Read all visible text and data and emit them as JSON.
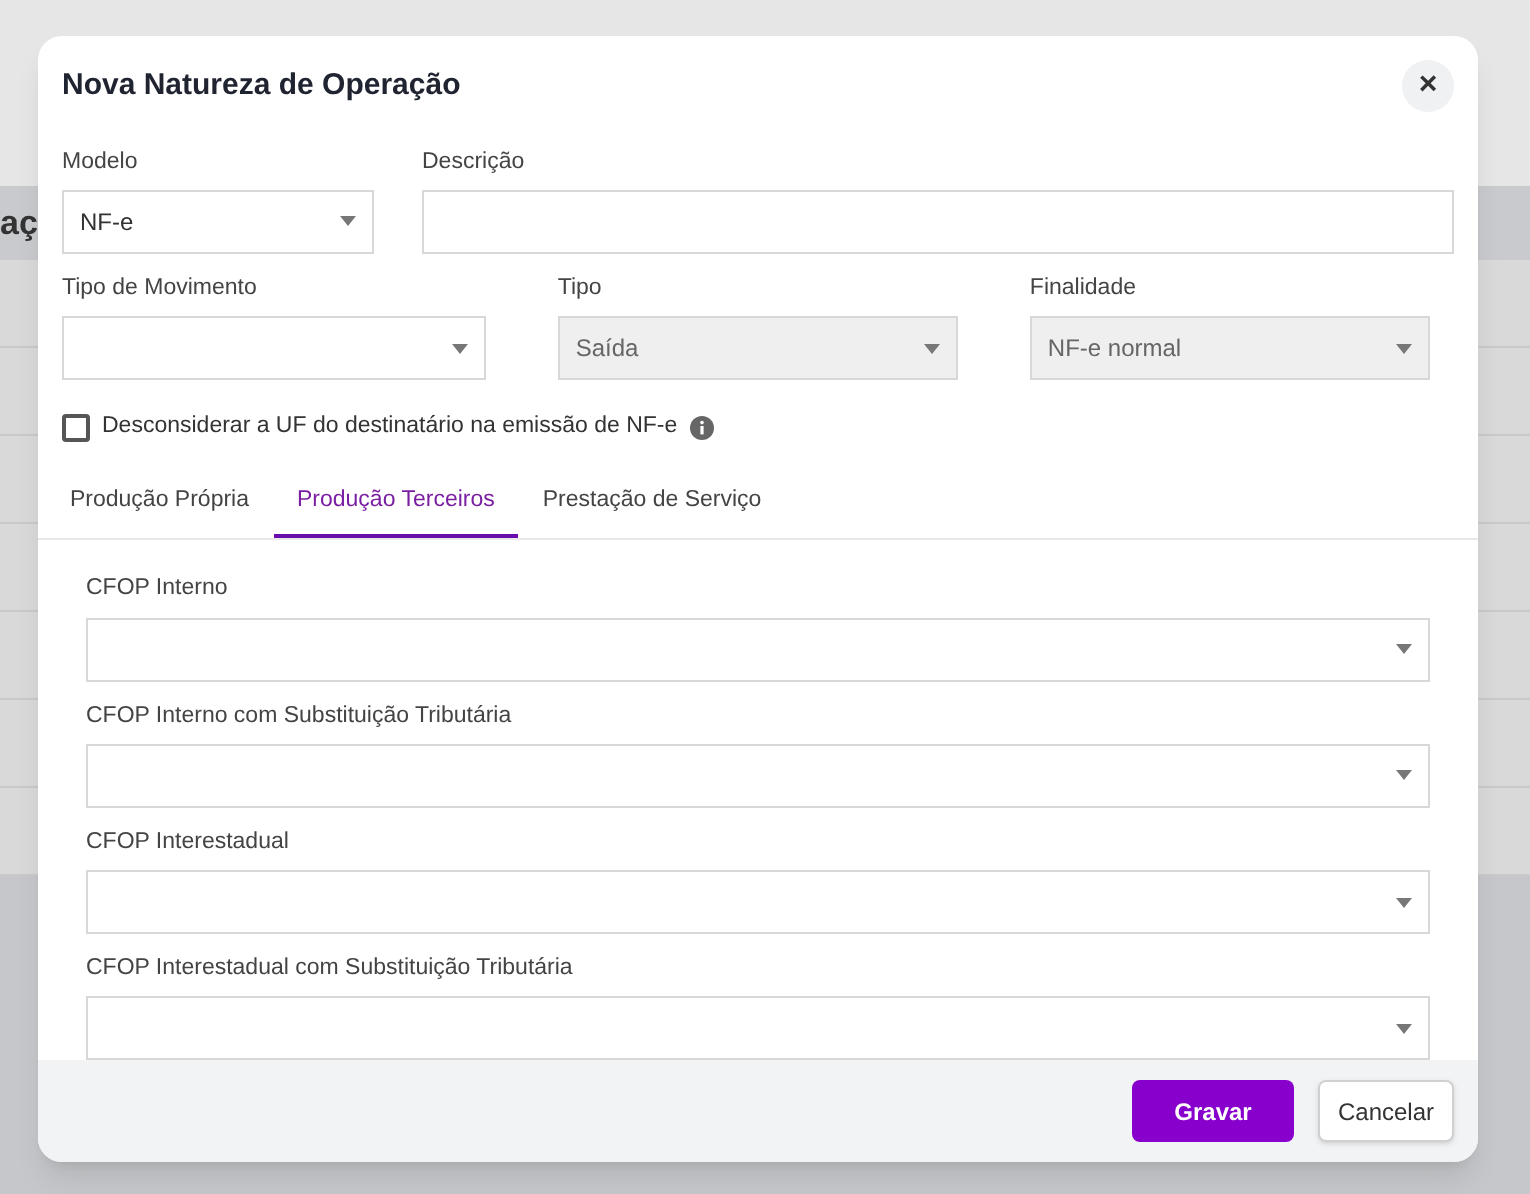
{
  "background_page": {
    "title_fragment": "aç"
  },
  "dialog": {
    "title": "Nova Natureza de Operação",
    "close_label": "×",
    "fields_row_1": [
      {
        "label": "Modelo",
        "kind": "select",
        "value": "NF-e",
        "disabled": false
      },
      {
        "label": "Descrição",
        "kind": "input",
        "disabled": false
      }
    ],
    "fields_row_2": [
      {
        "label": "Tipo de Movimento",
        "kind": "select",
        "disabled": false
      },
      {
        "label": "Tipo",
        "kind": "select",
        "value": "Saída",
        "disabled": true
      },
      {
        "label": "Finalidade",
        "kind": "select",
        "value": "NF-e normal",
        "disabled": true
      }
    ],
    "checkbox": {
      "label": "Desconsiderar a UF do destinatário na emissão de NF-e",
      "checked": false
    },
    "tabs": [
      {
        "label": "Produção Própria",
        "selected": false
      },
      {
        "label": "Produção Terceiros",
        "selected": true
      },
      {
        "label": "Prestação de Serviço",
        "selected": false
      }
    ],
    "cfop_fields": [
      {
        "label": "CFOP Interno"
      },
      {
        "label": "CFOP Interno com Substituição Tributária"
      },
      {
        "label": "CFOP Interestadual"
      },
      {
        "label": "CFOP Interestadual com Substituição Tributária"
      }
    ],
    "buttons": [
      {
        "label": "Gravar",
        "kind": "primary"
      },
      {
        "label": "Cancelar",
        "kind": "secondary"
      }
    ]
  }
}
